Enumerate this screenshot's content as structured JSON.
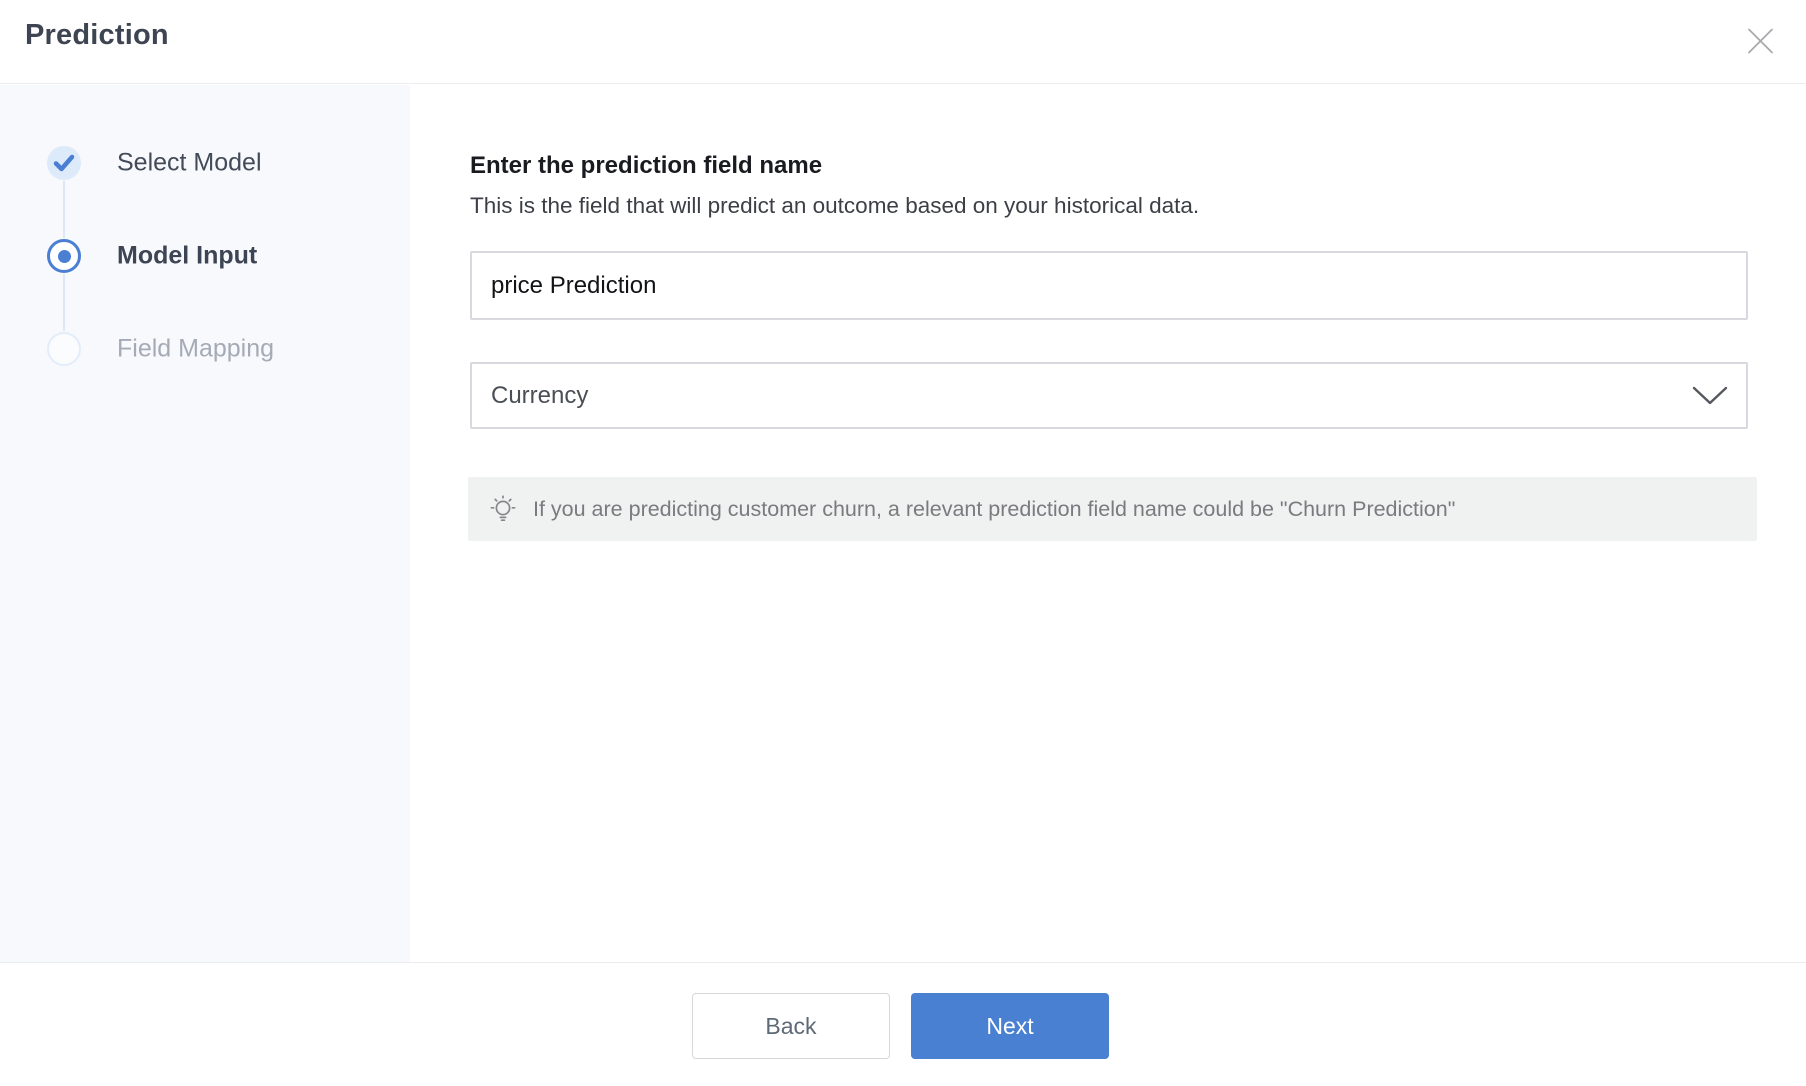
{
  "header": {
    "title": "Prediction",
    "close_icon": "x-icon"
  },
  "stepper": {
    "steps": [
      {
        "label": "Select Model",
        "state": "completed",
        "icon": "check-icon"
      },
      {
        "label": "Model Input",
        "state": "active",
        "icon": "radio-dot-icon"
      },
      {
        "label": "Field Mapping",
        "state": "pending",
        "icon": "empty-circle-icon"
      }
    ]
  },
  "form": {
    "heading": "Enter the prediction field name",
    "description": "This is the field that will predict an outcome based on your historical data.",
    "field_name_value": "price Prediction",
    "field_type_value": "Currency",
    "field_type_icon": "chevron-down-icon",
    "tip_icon": "lightbulb-icon",
    "tip_text": "If you are predicting customer churn, a relevant prediction field name could be \"Churn Prediction\""
  },
  "footer": {
    "back_label": "Back",
    "next_label": "Next"
  },
  "colors": {
    "accent_blue": "#4a7fd4",
    "next_button_blue": "#4a80d2",
    "sidebar_bg": "#f8f9fc",
    "completed_bullet_bg": "#ddeafa",
    "connector": "#dce8f6",
    "tip_bg": "#f0f1f1",
    "input_border": "#d7d9de",
    "inactive_step_text": "#a5abb6"
  }
}
